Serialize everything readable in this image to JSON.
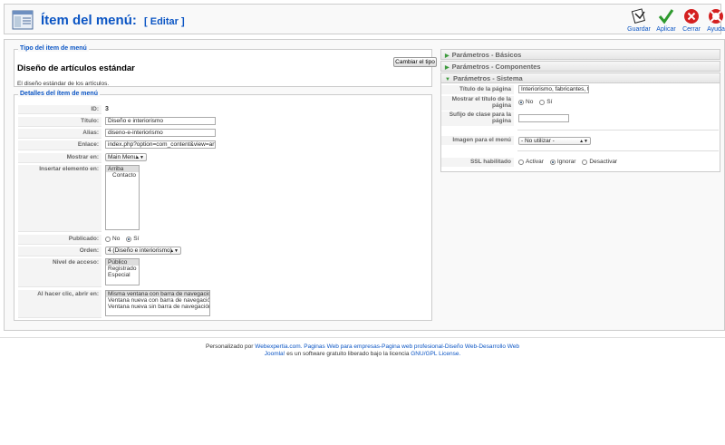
{
  "header": {
    "title": "Ítem del menú:",
    "edit_label": "[ Editar ]"
  },
  "toolbar": {
    "save_label": "Guardar",
    "apply_label": "Aplicar",
    "close_label": "Cerrar",
    "help_label": "Ayuda"
  },
  "type_section": {
    "legend": "Tipo del item de menú",
    "title": "Diseño de artículos estándar",
    "description": "El diseño estándar de los artículos.",
    "change_button": "Cambiar el tipo"
  },
  "details": {
    "legend": "Detalles del ítem de menú",
    "id_label": "ID:",
    "id_value": "3",
    "title_label": "Título:",
    "title_value": "Diseño e interiorismo",
    "alias_label": "Alias:",
    "alias_value": "diseno-e-interiorismo",
    "link_label": "Enlace:",
    "link_value": "index.php?option=com_content&view=artic",
    "menu_label": "Mostrar en:",
    "menu_value": "Main Menu",
    "parent_label": "Insertar elemento en:",
    "parent_options": [
      "Arriba",
      "Contacto"
    ],
    "published_label": "Publicado:",
    "published_no": "No",
    "published_yes": "Sí",
    "order_label": "Orden:",
    "order_value": "4 (Diseño e interiorismo)",
    "access_label": "Nivel de acceso:",
    "access_options": [
      "Público",
      "Registrado",
      "Especial"
    ],
    "click_label": "Al hacer clic, abrir en:",
    "click_options": [
      "Misma ventana con barra de navegación",
      "Ventana nueva con barra de navegación",
      "Ventana nueva sin barra de navegación"
    ]
  },
  "params": {
    "basic_label": "Parámetros - Básicos",
    "component_label": "Parámetros - Componentes",
    "system_label": "Parámetros - Sistema",
    "page_title_label": "Título de la página",
    "page_title_value": "Interiorismo, fabricantes, tap",
    "show_title_label": "Mostrar el título de la página",
    "show_title_no": "No",
    "show_title_yes": "Sí",
    "class_suffix_label": "Sufijo de clase para la página",
    "class_suffix_value": "",
    "menu_image_label": "Imagen para el menú",
    "menu_image_value": "- No utilizar -",
    "ssl_label": "SSL habilitado",
    "ssl_on": "Activar",
    "ssl_ignore": "Ignorar",
    "ssl_off": "Desactivar"
  },
  "footer": {
    "prefix": "Personalizado por",
    "link1": "Webexpertia.com. Paginas Web para empresas-Pagina web profesional-Diseño Web-Desarrollo Web",
    "link2": "Joomla!",
    "middle": "es un software gratuito liberado bajo la licencia",
    "link3": "GNU/GPL License."
  },
  "colors": {
    "accent": "#0b55c4",
    "save": "#222222",
    "apply": "#2e9a2e",
    "close": "#d42020"
  }
}
